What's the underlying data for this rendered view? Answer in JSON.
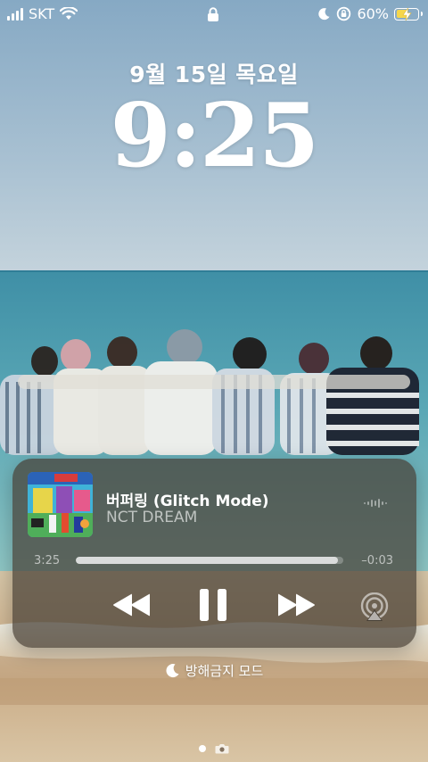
{
  "status_bar": {
    "carrier": "SKT",
    "battery_percent": "60%",
    "battery_level": 0.6,
    "battery_fill_color": "#f5d64b",
    "icons": [
      "signal-icon",
      "wifi-icon",
      "lock-icon",
      "moon-icon",
      "rotation-lock-icon",
      "battery-icon",
      "charging-bolt-icon"
    ]
  },
  "lock_screen": {
    "date": "9월 15일 목요일",
    "time": "9:25"
  },
  "now_playing": {
    "song_title": "버퍼링 (Glitch Mode)",
    "artist": "NCT DREAM",
    "elapsed": "3:25",
    "remaining": "–0:03",
    "progress": 0.98,
    "controls": [
      "rewind-icon",
      "pause-icon",
      "fast-forward-icon",
      "airplay-icon"
    ]
  },
  "focus": {
    "label": "방해금지 모드",
    "icon": "moon-icon"
  },
  "page_indicator": {
    "pages": [
      "dot",
      "camera"
    ],
    "active": 0
  }
}
